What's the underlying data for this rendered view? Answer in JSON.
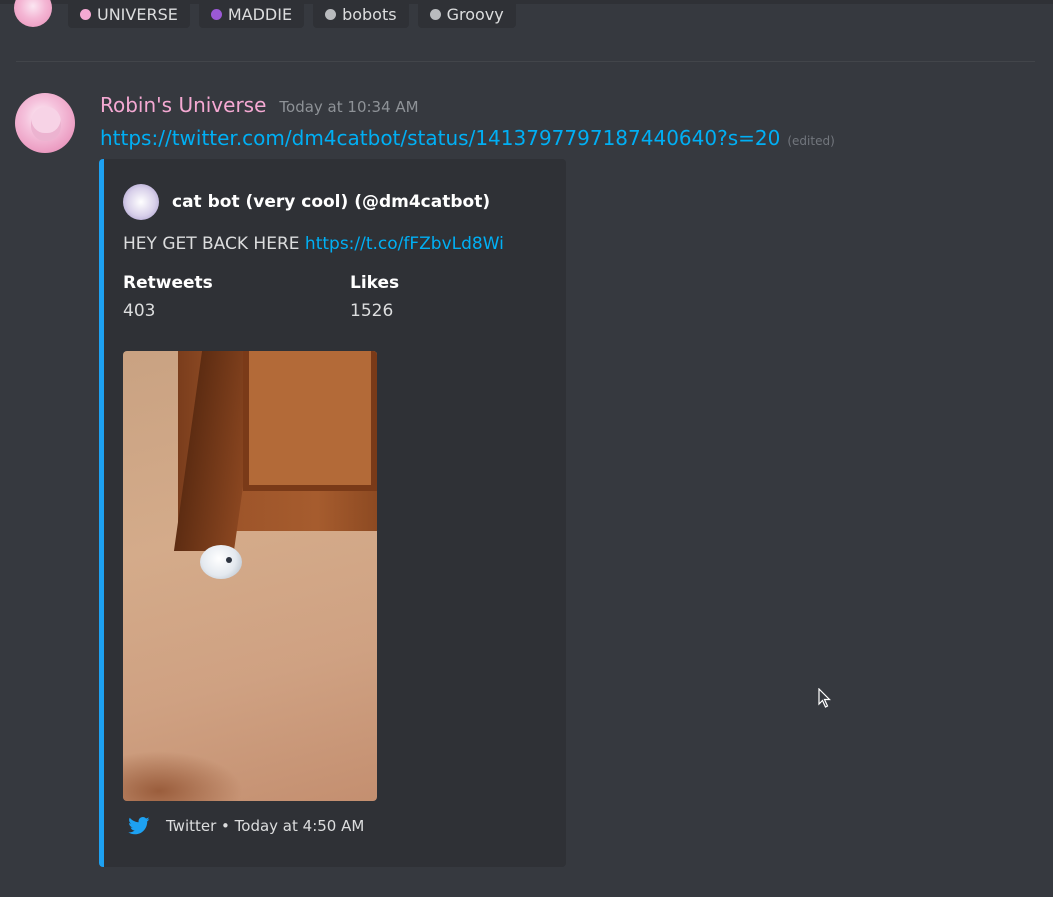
{
  "roles": [
    {
      "label": "UNIVERSE",
      "color": "#f5a9d3"
    },
    {
      "label": "MADDIE",
      "color": "#9b59d6"
    },
    {
      "label": "bobots",
      "color": "#b9bbbe"
    },
    {
      "label": "Groovy",
      "color": "#b9bbbe"
    }
  ],
  "message": {
    "author": "Robin's Universe",
    "author_color": "#f5a9d3",
    "timestamp": "Today at 10:34 AM",
    "link": "https://twitter.com/dm4catbot/status/1413797797187440640?s=20",
    "edited_label": "(edited)"
  },
  "embed": {
    "accent_color": "#1da1f2",
    "author": "cat bot (very cool) (@dm4catbot)",
    "description_text": "HEY GET BACK HERE ",
    "description_link": "https://t.co/fFZbvLd8Wi",
    "fields": [
      {
        "name": "Retweets",
        "value": "403"
      },
      {
        "name": "Likes",
        "value": "1526"
      }
    ],
    "footer": "Twitter • Today at 4:50 AM",
    "footer_icon": "twitter-bird-icon"
  }
}
